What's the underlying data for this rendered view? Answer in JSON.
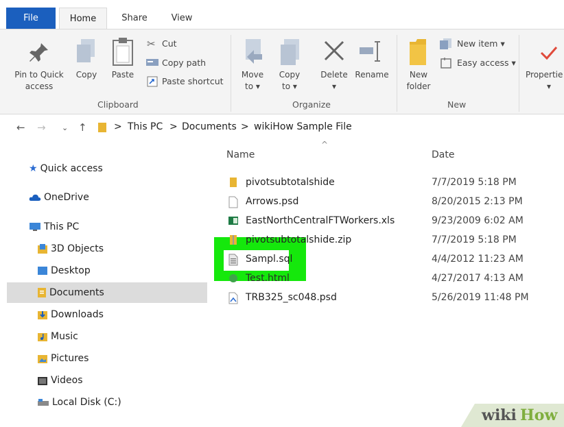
{
  "tabs": [
    {
      "label": "File"
    },
    {
      "label": "Home"
    },
    {
      "label": "Share"
    },
    {
      "label": "View"
    }
  ],
  "ribbon": {
    "pin_label_1": "Pin to Quick",
    "pin_label_2": "access",
    "copy_label": "Copy",
    "paste_label": "Paste",
    "cut_label": "Cut",
    "copy_path_label": "Copy path",
    "paste_shortcut_label": "Paste shortcut",
    "clipboard_group": "Clipboard",
    "move_to_label_1": "Move",
    "move_to_label_2": "to ▾",
    "copy_to_label_1": "Copy",
    "copy_to_label_2": "to ▾",
    "delete_label": "Delete",
    "delete_arrow": "▾",
    "rename_label": "Rename",
    "organize_group": "Organize",
    "new_folder_label_1": "New",
    "new_folder_label_2": "folder",
    "new_item_label": "New item ▾",
    "easy_access_label": "Easy access ▾",
    "new_group": "New",
    "properties_label": "Propertie",
    "properties_arrow": "▾"
  },
  "address": {
    "this_pc": "This PC",
    "documents": "Documents",
    "folder": "wikiHow Sample File",
    "sep": ">"
  },
  "sidebar": {
    "items": [
      {
        "label": "Quick access"
      },
      {
        "label": "OneDrive"
      },
      {
        "label": "This PC"
      },
      {
        "label": "3D Objects"
      },
      {
        "label": "Desktop"
      },
      {
        "label": "Documents"
      },
      {
        "label": "Downloads"
      },
      {
        "label": "Music"
      },
      {
        "label": "Pictures"
      },
      {
        "label": "Videos"
      },
      {
        "label": "Local Disk (C:)"
      }
    ]
  },
  "filelist": {
    "col_name": "Name",
    "col_date": "Date",
    "sort_indicator": "^",
    "rows": [
      {
        "name": "pivotsubtotalshide",
        "date": "7/7/2019 5:18 PM"
      },
      {
        "name": "Arrows.psd",
        "date": "8/20/2015 2:13 PM"
      },
      {
        "name": "EastNorthCentralFTWorkers.xls",
        "date": "9/23/2009 6:02 AM"
      },
      {
        "name": "pivotsubtotalshide.zip",
        "date": "7/7/2019 5:18 PM"
      },
      {
        "name": "Sampl.sql",
        "date": "4/4/2012 11:23 AM"
      },
      {
        "name": "Test.html",
        "date": "4/27/2017 4:13 AM"
      },
      {
        "name": "TRB325_sc048.psd",
        "date": "5/26/2019 11:48 PM"
      }
    ]
  },
  "watermark": {
    "wiki": "wiki",
    "how": "How"
  },
  "colors": {
    "file_tab": "#1b5fbe",
    "highlight": "#15e80c",
    "folder": "#e8b533",
    "selected": "#dcdcdc"
  }
}
